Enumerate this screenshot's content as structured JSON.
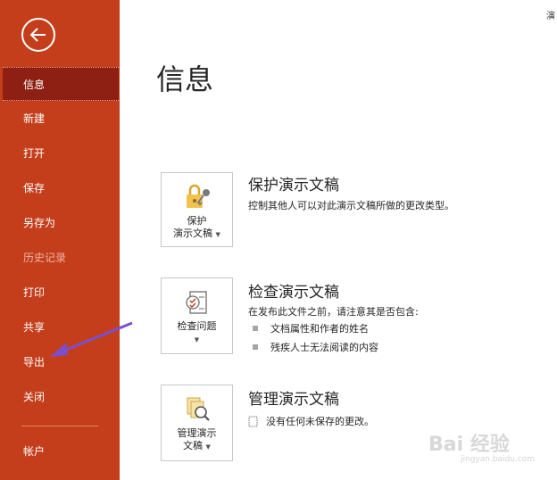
{
  "app": {
    "corner_text": "演"
  },
  "sidebar": {
    "items": [
      {
        "label": "信息",
        "state": "active"
      },
      {
        "label": "新建",
        "state": "normal"
      },
      {
        "label": "打开",
        "state": "normal"
      },
      {
        "label": "保存",
        "state": "normal"
      },
      {
        "label": "另存为",
        "state": "normal"
      },
      {
        "label": "历史记录",
        "state": "disabled"
      },
      {
        "label": "打印",
        "state": "normal"
      },
      {
        "label": "共享",
        "state": "normal"
      },
      {
        "label": "导出",
        "state": "normal"
      },
      {
        "label": "关闭",
        "state": "normal"
      }
    ],
    "account_label": "帐户",
    "back_icon": "back-arrow-icon"
  },
  "main": {
    "title": "信息",
    "protect": {
      "button_line1": "保护",
      "button_line2": "演示文稿",
      "title": "保护演示文稿",
      "description": "控制其他人可以对此演示文稿所做的更改类型。",
      "icon": "lock-key-icon"
    },
    "inspect": {
      "button_label": "检查问题",
      "title": "检查演示文稿",
      "description": "在发布此文件之前，请注意其是否包含:",
      "bullets": [
        "文档属性和作者的姓名",
        "残疾人士无法阅读的内容"
      ],
      "icon": "checklist-icon"
    },
    "manage": {
      "button_line1": "管理演示",
      "button_line2": "文稿",
      "title": "管理演示文稿",
      "description": "没有任何未保存的更改。",
      "icon": "manage-documents-icon"
    }
  },
  "watermark": {
    "main": "Bai 经验",
    "sub": "jingyan.baidu.com"
  },
  "colors": {
    "sidebar": "#c43e1c",
    "sidebar_active": "#8e1f13",
    "annotation_arrow": "#7b4fc9"
  }
}
